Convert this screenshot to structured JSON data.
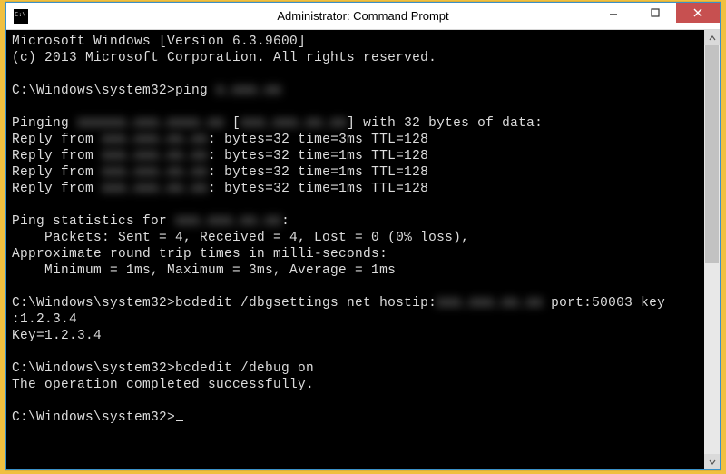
{
  "window": {
    "title": "Administrator: Command Prompt"
  },
  "console": {
    "header1": "Microsoft Windows [Version 6.3.9600]",
    "header2": "(c) 2013 Microsoft Corporation. All rights reserved.",
    "prompt": "C:\\Windows\\system32>",
    "ping_cmd_prefix": "C:\\Windows\\system32>ping ",
    "ping_cmd_target_masked": "x.xxx.xx",
    "pinging_prefix": "Pinging ",
    "pinging_host_masked": "xxxxxx.xxx.xxxx.xx",
    "pinging_mid": " [",
    "pinging_ip_masked": "xxx.xxx.xx.xx",
    "pinging_suffix": "] with 32 bytes of data:",
    "reply_prefix": "Reply from ",
    "reply_ip_masked": "xxx.xxx.xx.xx",
    "reply_colon": ": ",
    "replies": [
      "bytes=32 time=3ms TTL=128",
      "bytes=32 time=1ms TTL=128",
      "bytes=32 time=1ms TTL=128",
      "bytes=32 time=1ms TTL=128"
    ],
    "stats_prefix": "Ping statistics for ",
    "stats_ip_masked": "xxx.xxx.xx.xx",
    "stats_colon": ":",
    "packets": "    Packets: Sent = 4, Received = 4, Lost = 0 (0% loss),",
    "approx": "Approximate round trip times in milli-seconds:",
    "minmax": "    Minimum = 1ms, Maximum = 3ms, Average = 1ms",
    "bcd1_prefix": "C:\\Windows\\system32>bcdedit /dbgsettings net hostip:",
    "bcd1_ip_masked": "xxx.xxx.xx.xx",
    "bcd1_suffix": " port:50003 key",
    "bcd1_cont": ":1.2.3.4",
    "bcd1_key": "Key=1.2.3.4",
    "bcd2_cmd": "C:\\Windows\\system32>bcdedit /debug on",
    "bcd2_result": "The operation completed successfully.",
    "final_prompt": "C:\\Windows\\system32>"
  }
}
